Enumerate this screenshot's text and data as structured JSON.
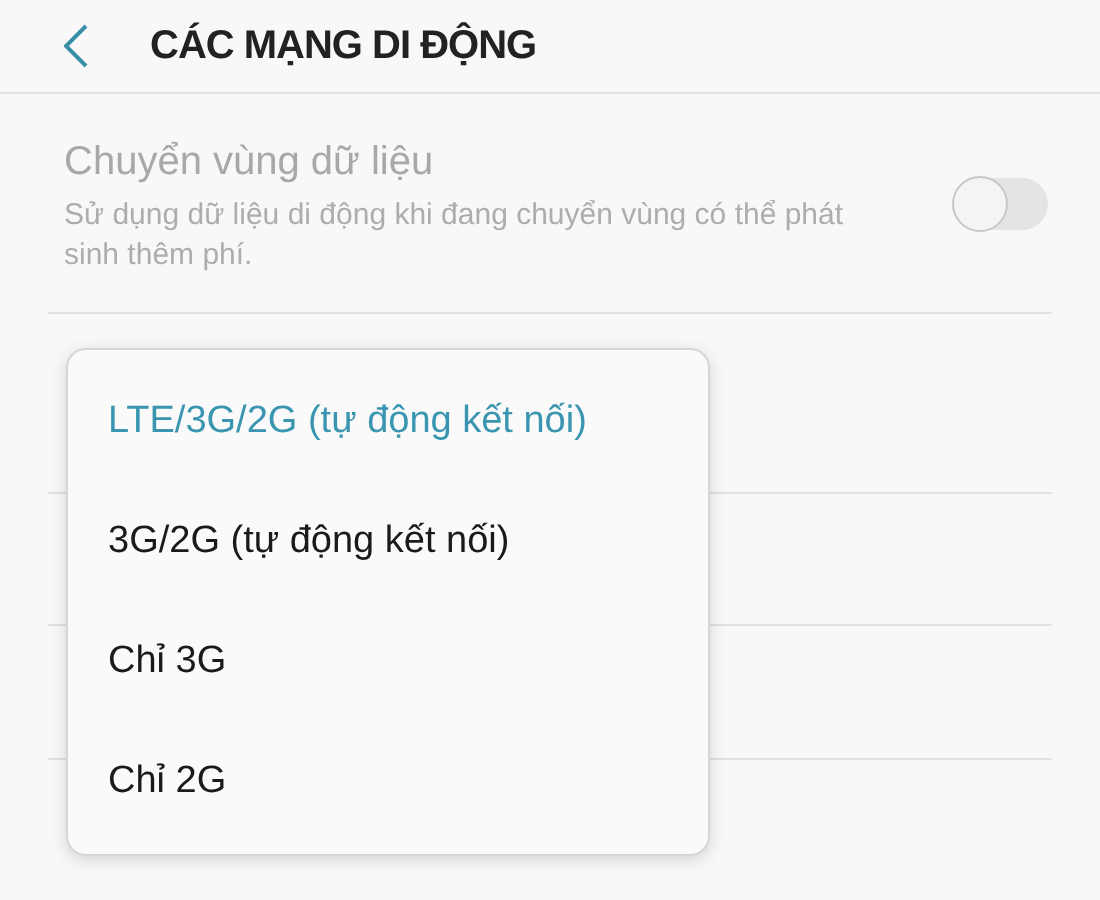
{
  "header": {
    "title": "CÁC MẠNG DI ĐỘNG"
  },
  "roaming": {
    "title": "Chuyển vùng dữ liệu",
    "description": "Sử dụng dữ liệu di động khi đang chuyển vùng có thể phát sinh thêm phí.",
    "on": false
  },
  "network_mode_menu": [
    {
      "label": "LTE/3G/2G (tự động kết nối)",
      "selected": true
    },
    {
      "label": "3G/2G (tự động kết nối)",
      "selected": false
    },
    {
      "label": "Chỉ 3G",
      "selected": false
    },
    {
      "label": "Chỉ 2G",
      "selected": false
    }
  ]
}
